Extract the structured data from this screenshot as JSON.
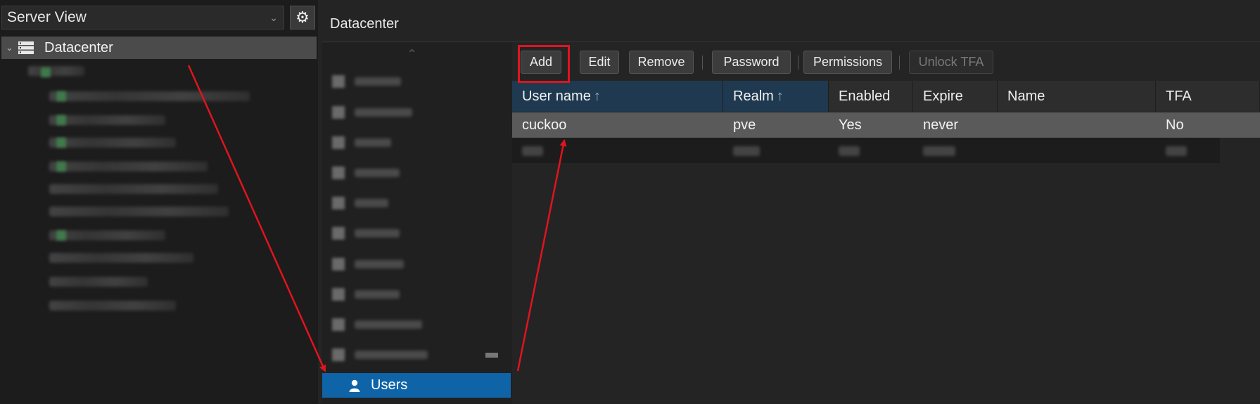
{
  "left_panel": {
    "view_selector": {
      "value": "Server View",
      "chevron_icon": "chevron-down-icon"
    },
    "settings_icon": "gear-icon",
    "tree": {
      "root_label": "Datacenter",
      "root_icon": "server-rack-icon",
      "toggle_icon": "chevron-down-icon"
    }
  },
  "main": {
    "title": "Datacenter",
    "nav": {
      "scroll_up_icon": "chevron-up-icon",
      "selected_item": {
        "label": "Users",
        "icon": "user-icon"
      }
    },
    "toolbar": {
      "add_label": "Add",
      "edit_label": "Edit",
      "remove_label": "Remove",
      "password_label": "Password",
      "permissions_label": "Permissions",
      "unlock_tfa_label": "Unlock TFA"
    },
    "grid": {
      "columns": [
        "User name",
        "Realm",
        "Enabled",
        "Expire",
        "Name",
        "TFA"
      ],
      "sort_icon": "↑",
      "rows": [
        {
          "user_name": "cuckoo",
          "realm": "pve",
          "enabled": "Yes",
          "expire": "never",
          "name": "",
          "tfa": "No"
        }
      ]
    }
  },
  "colors": {
    "selected_nav": "#0f64a8",
    "sorted_header": "#1f3a50",
    "annotation_red": "#e0141e",
    "selected_row": "#5a5a5a"
  }
}
